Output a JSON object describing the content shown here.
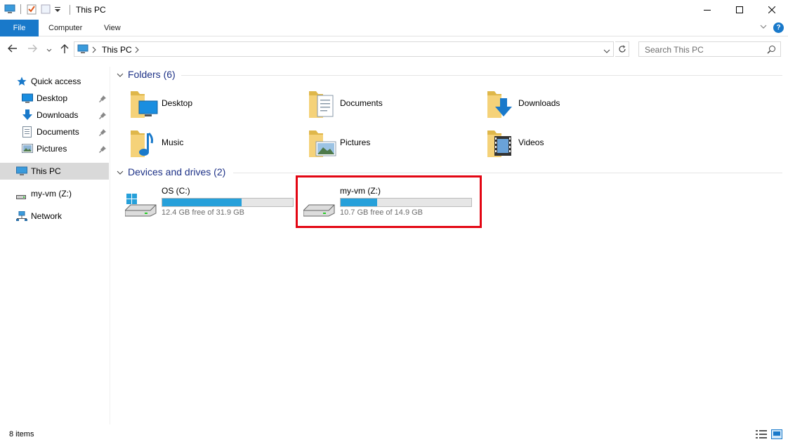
{
  "window": {
    "title": "This PC"
  },
  "ribbon": {
    "tabs": [
      {
        "label": "File"
      },
      {
        "label": "Computer"
      },
      {
        "label": "View"
      }
    ]
  },
  "address": {
    "path": "This PC",
    "search_placeholder": "Search This PC"
  },
  "sidebar": {
    "quick_access": {
      "label": "Quick access"
    },
    "pinned": [
      {
        "label": "Desktop"
      },
      {
        "label": "Downloads"
      },
      {
        "label": "Documents"
      },
      {
        "label": "Pictures"
      }
    ],
    "this_pc": {
      "label": "This PC"
    },
    "drive": {
      "label": "my-vm (Z:)"
    },
    "network": {
      "label": "Network"
    }
  },
  "folders_section": {
    "title": "Folders (6)",
    "items": [
      {
        "label": "Desktop",
        "icon": "desktop-folder-icon"
      },
      {
        "label": "Documents",
        "icon": "documents-folder-icon"
      },
      {
        "label": "Downloads",
        "icon": "downloads-folder-icon"
      },
      {
        "label": "Music",
        "icon": "music-folder-icon"
      },
      {
        "label": "Pictures",
        "icon": "pictures-folder-icon"
      },
      {
        "label": "Videos",
        "icon": "videos-folder-icon"
      }
    ]
  },
  "drives_section": {
    "title": "Devices and drives (2)",
    "items": [
      {
        "name": "OS (C:)",
        "free_text": "12.4 GB free of 31.9 GB",
        "used_fraction": 0.61
      },
      {
        "name": "my-vm (Z:)",
        "free_text": "10.7 GB free of 14.9 GB",
        "used_fraction": 0.28
      }
    ]
  },
  "status": {
    "items_count": "8 items"
  },
  "colors": {
    "accent": "#1979ca",
    "drive_bar": "#26a0da",
    "highlight": "#e30613",
    "section_header": "#1e3287"
  }
}
